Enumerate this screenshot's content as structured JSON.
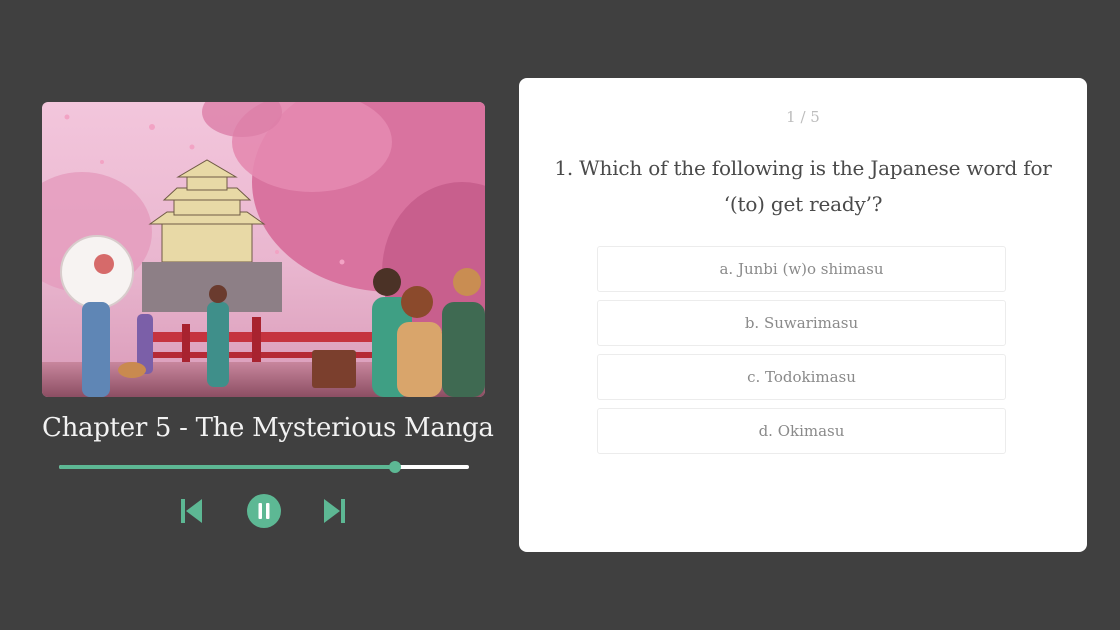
{
  "player": {
    "cover_alt": "Anime illustration of a castle surrounded by cherry blossom trees",
    "chapter_title": "Chapter 5 - The Mysterious Manga",
    "progress_fraction": 0.82,
    "controls": {
      "prev": "skip-previous-icon",
      "pause": "pause-icon",
      "next": "skip-next-icon"
    },
    "accent_color": "#5db894"
  },
  "quiz": {
    "counter": "1 / 5",
    "question": "1. Which of the following is the Japanese word for ‘(to) get ready’?",
    "options": [
      {
        "label": "a. Junbi (w)o shimasu"
      },
      {
        "label": "b. Suwarimasu"
      },
      {
        "label": "c. Todokimasu"
      },
      {
        "label": "d. Okimasu"
      }
    ]
  },
  "colors": {
    "background": "#404040",
    "card": "#ffffff",
    "accent": "#5db894"
  }
}
